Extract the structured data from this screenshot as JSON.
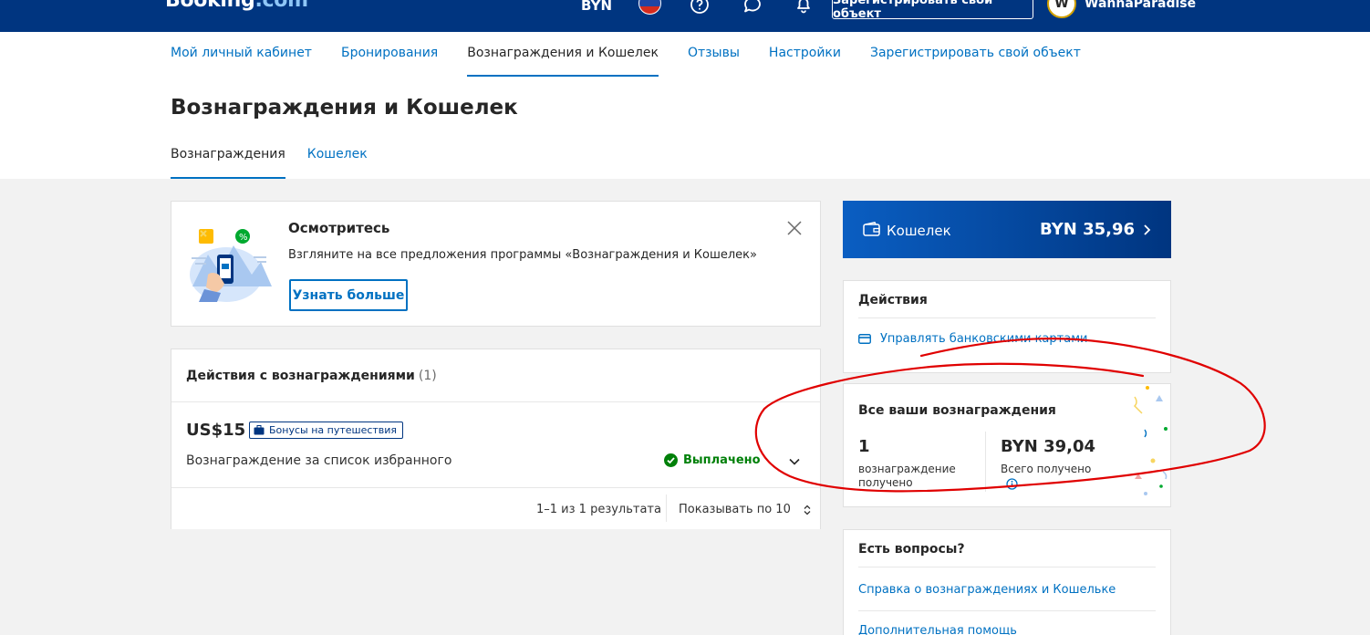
{
  "header": {
    "logo_main": "Booking",
    "logo_suffix": ".com",
    "currency": "BYN",
    "register_button": "Зарегистрировать свой объект",
    "avatar_initial": "W",
    "username": "WannaParadise"
  },
  "nav": {
    "items": [
      {
        "label": "Мой личный кабинет"
      },
      {
        "label": "Бронирования"
      },
      {
        "label": "Вознаграждения и Кошелек"
      },
      {
        "label": "Отзывы"
      },
      {
        "label": "Настройки"
      },
      {
        "label": "Зарегистрировать свой объект"
      }
    ],
    "active_index": 2
  },
  "page": {
    "title": "Вознаграждения и Кошелек",
    "subtabs": [
      {
        "label": "Вознаграждения"
      },
      {
        "label": "Кошелек"
      }
    ]
  },
  "promo": {
    "title": "Осмотритесь",
    "text": "Взгляните на все предложения программы «Вознаграждения и Кошелек»",
    "button": "Узнать больше"
  },
  "rewards_activity": {
    "title": "Действия с вознаграждениями",
    "count": "(1)",
    "item": {
      "amount": "US$15",
      "badge": "Бонусы на путешествия",
      "description": "Вознаграждение за список избранного",
      "status": "Выплачено"
    },
    "pagination": {
      "range": "1–1 из 1 результата",
      "per_page": "Показывать по 10"
    }
  },
  "wallet": {
    "label": "Кошелек",
    "value": "BYN 35,96"
  },
  "actions": {
    "title": "Действия",
    "link": "Управлять банковскими картами"
  },
  "all_rewards": {
    "title": "Все ваши вознаграждения",
    "count": "1",
    "count_label": "вознаграждение получено",
    "total": "BYN 39,04",
    "total_label": "Всего получено"
  },
  "faq": {
    "title": "Есть вопросы?",
    "link1": "Справка о вознаграждениях и Кошельке",
    "link2": "Дополнительная помощь"
  },
  "colors": {
    "brand_dark": "#003580",
    "link": "#0071c2",
    "success": "#008009",
    "annotation_red": "#e00000"
  }
}
